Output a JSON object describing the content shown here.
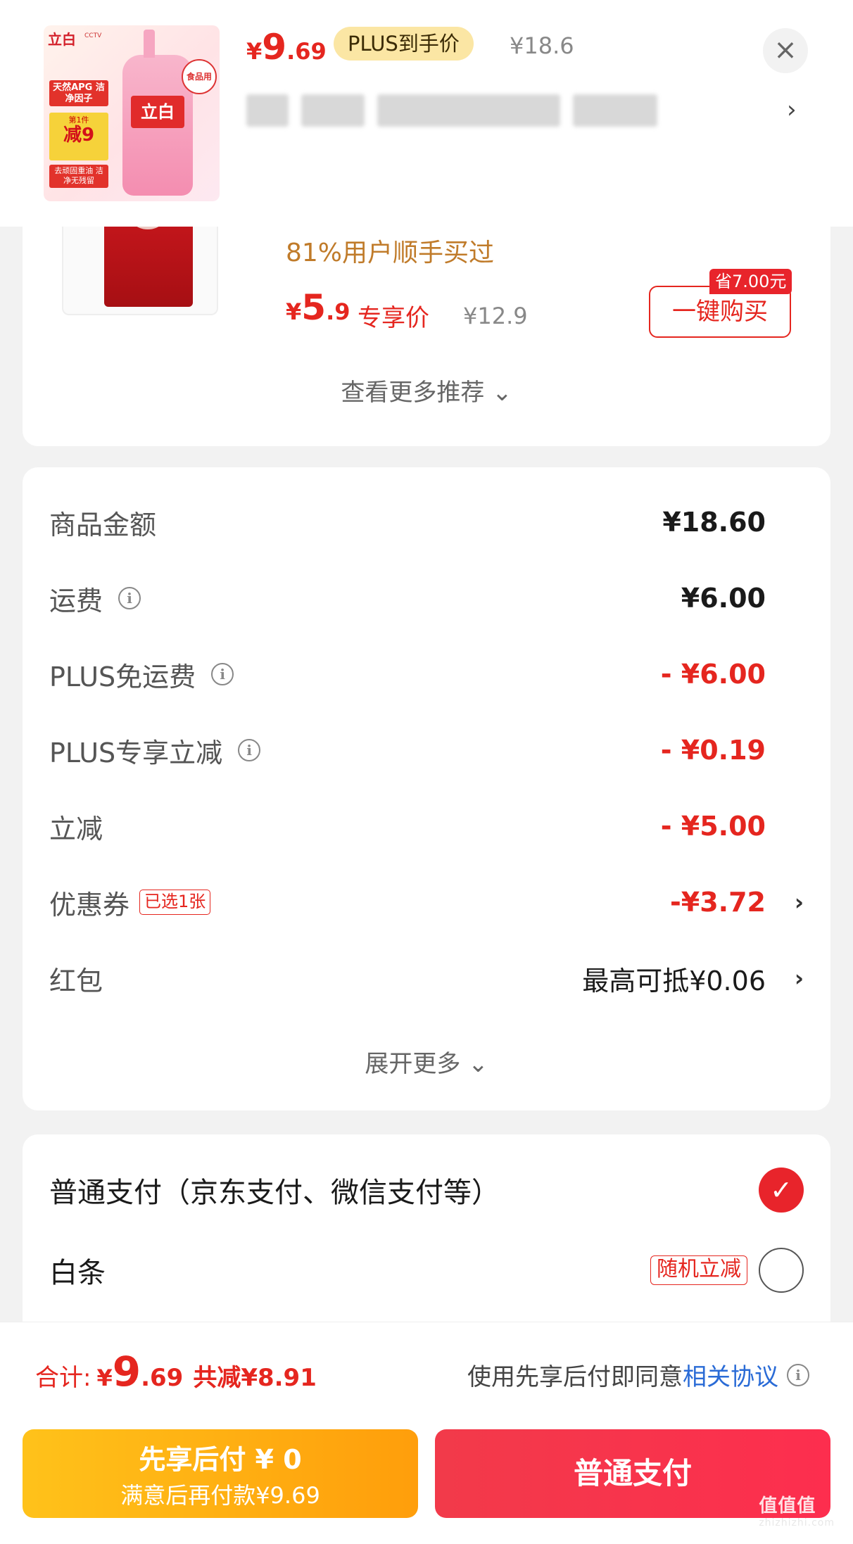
{
  "header": {
    "thumbnail": {
      "brand": "立白",
      "cctv": "CCTV",
      "apg": "天然APG 洁净因子",
      "sale_line1": "第1件",
      "sale_line2": "减9",
      "features": "去顽固重油 洁净无残留",
      "bottle_label": "立白",
      "food_grade": "食品用"
    },
    "price_yen": "¥",
    "price_int": "9",
    "price_dec": ".69",
    "plus_label": "PLUS到手价",
    "original_price": "¥18.6",
    "close_icon": "×",
    "chevron": "›"
  },
  "recommend": {
    "tag": "81%用户顺手买过",
    "price_yen": "¥",
    "price_int": "5",
    "price_dec": ".9",
    "price_label": "专享价",
    "original_price": "¥12.9",
    "save_tag": "省7.00元",
    "buy_button": "一键购买",
    "more": "查看更多推荐 ⌄"
  },
  "order_summary": {
    "rows": [
      {
        "label": "商品金额",
        "value": "¥18.60"
      },
      {
        "label": "运费",
        "value": "¥6.00"
      },
      {
        "label": "PLUS免运费",
        "value": "- ¥6.00"
      },
      {
        "label": "PLUS专享立减",
        "value": "- ¥0.19"
      },
      {
        "label": "立减",
        "value": "- ¥5.00"
      },
      {
        "label": "优惠券",
        "badge": "已选1张",
        "value": "-¥3.72"
      },
      {
        "label": "红包",
        "value": "最高可抵¥0.06"
      }
    ],
    "chevron": "›",
    "info_icon": "i",
    "expand": "展开更多 ⌄"
  },
  "payment": {
    "options": [
      {
        "label": "普通支付（京东支付、微信支付等）",
        "selected": true
      },
      {
        "label": "白条",
        "badge": "随机立减",
        "selected": false
      }
    ],
    "check": "✓"
  },
  "footer": {
    "total_label": "合计:",
    "total_yen": "¥",
    "total_int": "9",
    "total_dec": ".69",
    "total_saved": "共减¥8.91",
    "agree_text": "使用先享后付即同意",
    "agree_link": "相关协议",
    "btn_later_line1": "先享后付 ¥ 0",
    "btn_later_line2": "满意后再付款¥9.69",
    "btn_pay": "普通支付",
    "watermark": "值值值",
    "watermark_url": "zhizhizhi.com"
  },
  "colors": {
    "accent_red": "#e5261f",
    "plus_gold": "#fbe6a4",
    "link_blue": "#2a6bd6",
    "btn_orange": "#ffb012",
    "btn_red": "#f5354b"
  }
}
